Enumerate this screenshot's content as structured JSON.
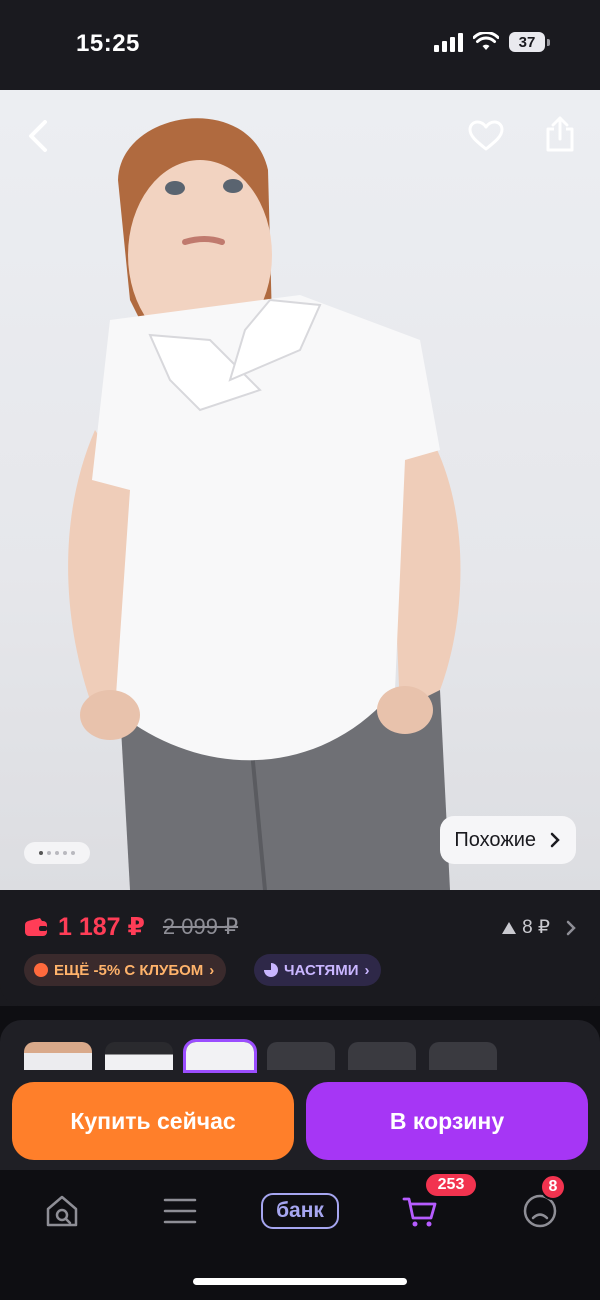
{
  "status_bar": {
    "time": "15:25",
    "battery": "37"
  },
  "hero": {
    "back_icon": "chevron-left-icon",
    "favorite_icon": "heart-icon",
    "share_icon": "share-icon",
    "image_pages": 5,
    "image_current": 1,
    "similar_label": "Похожие"
  },
  "price": {
    "current": "1 187 ₽",
    "old": "2 099 ₽",
    "bonus": "8 ₽",
    "club_chip": "ЕЩЁ -5% С КЛУБОМ",
    "parts_chip": "ЧАСТЯМИ"
  },
  "actions": {
    "buy_now": "Купить сейчас",
    "to_cart": "В корзину"
  },
  "tabbar": {
    "bank_label": "банк",
    "cart_badge": "253",
    "profile_badge": "8"
  },
  "colors": {
    "price": "#ff3d57",
    "buy": "#ff7f2a",
    "cart": "#a636f5",
    "badge": "#f2334f"
  }
}
